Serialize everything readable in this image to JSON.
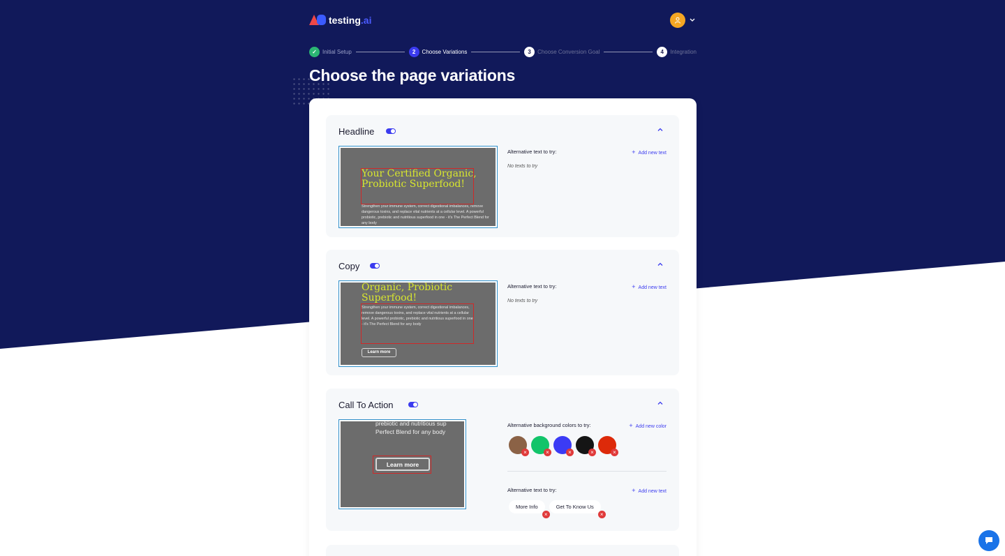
{
  "brand": {
    "name": "testing",
    "suffix": ".ai"
  },
  "stepper": [
    {
      "num": "✓",
      "label": "Initial Setup",
      "state": "done"
    },
    {
      "num": "2",
      "label": "Choose Variations",
      "state": "active"
    },
    {
      "num": "3",
      "label": "Choose Conversion Goal",
      "state": "todo"
    },
    {
      "num": "4",
      "label": "Integration",
      "state": "todo"
    }
  ],
  "page_title": "Choose the page variations",
  "preview_text": {
    "headline": "Your Certified Organic, Probiotic Superfood!",
    "headline_partial": "Organic, Probiotic Superfood!",
    "body": "Strengthen your immune system, correct digestional imbalances, remove dangerous toxins, and replace vital nutrients at a cellular level. A powerful probiotic, prebiotic and nutritious superfood in one - it's The Perfect Blend for any body",
    "cta_context_1": "prebiotic and nutritious sup",
    "cta_context_2": "Perfect Blend for any body",
    "button": "Learn more"
  },
  "sections": {
    "headline": {
      "title": "Headline",
      "alt_label": "Alternative text to try:",
      "add_label": "Add new text",
      "empty": "No texts to try"
    },
    "copy": {
      "title": "Copy",
      "alt_label": "Alternative text to try:",
      "add_label": "Add new text",
      "empty": "No texts to try"
    },
    "cta": {
      "title": "Call To Action",
      "colors_label": "Alternative background colors to try:",
      "add_color_label": "Add new color",
      "colors": [
        "#8b6246",
        "#12c46a",
        "#3b3bf5",
        "#151515",
        "#dd2a0a"
      ],
      "alt_label": "Alternative text to try:",
      "add_label": "Add new text",
      "texts": [
        "More Info",
        "Get To Know Us"
      ]
    }
  },
  "remove_icon": "×",
  "theme": {
    "navy": "#11195a",
    "accent": "#3b3bef",
    "success": "#2bb673",
    "avatar": "#f5a623"
  }
}
